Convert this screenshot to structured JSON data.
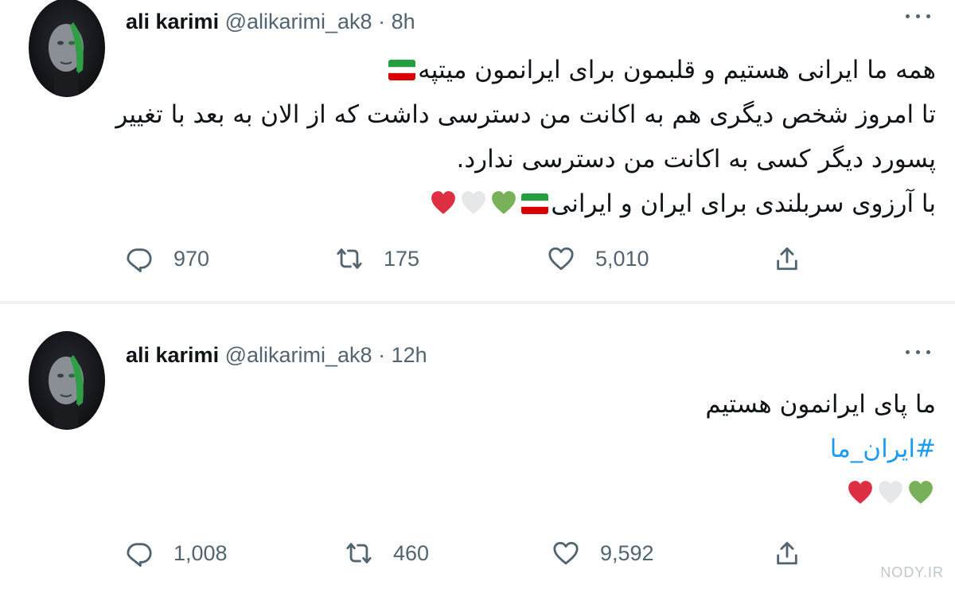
{
  "tweets": [
    {
      "author_name": "ali karimi",
      "author_handle": "@alikarimi_ak8",
      "time": "· 8h",
      "lines": [
        "همه ما ایرانی هستیم و قلبمون برای ایرانمون میتپه",
        "تا امروز شخص دیگری هم به اکانت من دسترسی داشت که از الان به بعد با تغییر",
        "پسورد دیگر کسی به اکانت من دسترسی ندارد.",
        "با آرزوی سربلندی برای ایران و ایرانی"
      ],
      "reply_count": "970",
      "retweet_count": "175",
      "like_count": "5,010"
    },
    {
      "author_name": "ali karimi",
      "author_handle": "@alikarimi_ak8",
      "time": "· 12h",
      "lines": [
        "ما پای ایرانمون هستیم"
      ],
      "hashtag": "#ایران_ما",
      "reply_count": "1,008",
      "retweet_count": "460",
      "like_count": "9,592"
    }
  ],
  "watermark": "NODY.IR",
  "colors": {
    "text": "#0f1419",
    "secondary": "#536471",
    "link": "#1d9bf0",
    "heart_green": "#78b159",
    "heart_white": "#e6e7e8",
    "heart_red": "#dd2e44"
  },
  "icons": [
    "reply-icon",
    "retweet-icon",
    "like-icon",
    "share-icon",
    "more-icon",
    "iran-flag-emoji",
    "green-heart-emoji",
    "white-heart-emoji",
    "red-heart-emoji"
  ]
}
